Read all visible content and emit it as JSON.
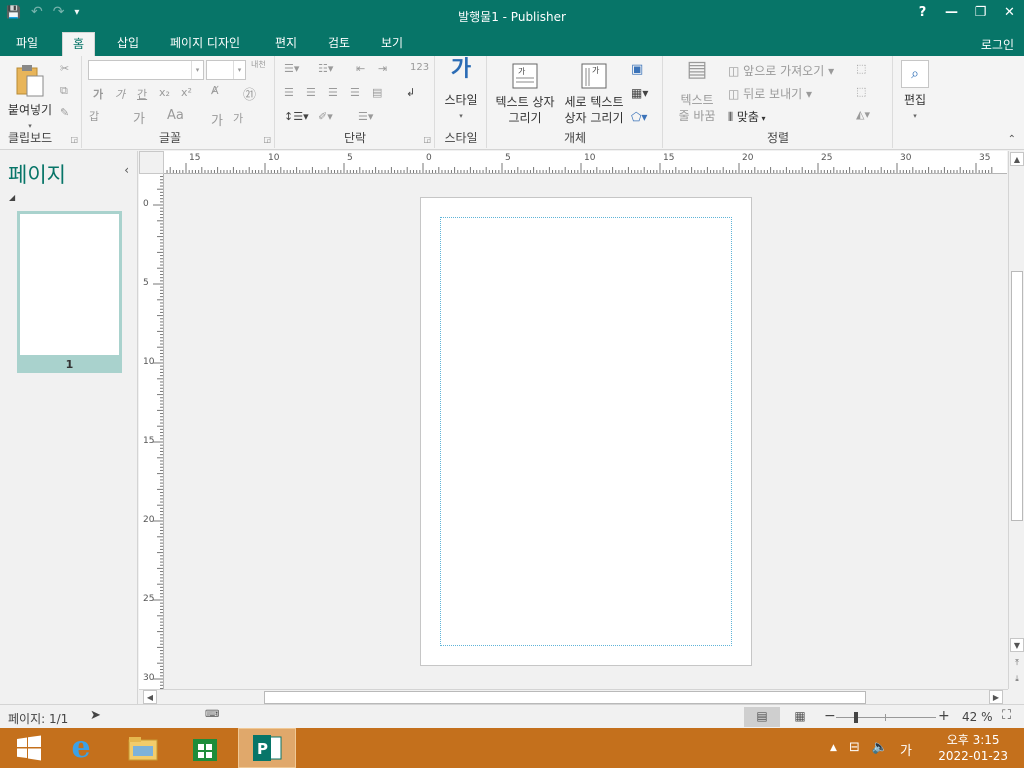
{
  "window": {
    "title": "발행물1 - Publisher",
    "controls": {
      "help": "?",
      "minimize": "—",
      "restore": "❐",
      "close": "✕"
    }
  },
  "qat": {
    "save_icon": "💾",
    "undo_icon": "↶",
    "redo_icon": "↷",
    "customize_icon": "▾"
  },
  "ribbon": {
    "tabs": [
      "파일",
      "홈",
      "삽입",
      "페이지 디자인",
      "편지",
      "검토",
      "보기"
    ],
    "active_tab": "홈",
    "login": "로그인",
    "clipboard": {
      "paste_label": "붙여넣기",
      "group_label": "클립보드"
    },
    "font": {
      "group_label": "글꼴",
      "font_name": "",
      "font_size": "",
      "bold": "가",
      "italic": "가",
      "underline": "간",
      "subscript": "x₂",
      "superscript": "x²",
      "char_spacing": "갑",
      "change_case": "Aa",
      "font_color": "가",
      "grow": "가",
      "shrink": "가",
      "ruby": "내천",
      "enclose": "㉑"
    },
    "paragraph": {
      "group_label": "단락",
      "numbering": "123"
    },
    "styles": {
      "label": "스타일",
      "group_label": "스타일"
    },
    "objects": {
      "group_label": "개체",
      "text_box_label_1": "텍스트 상자",
      "text_box_label_2": "그리기",
      "vertical_text_label_1": "세로 텍스트",
      "vertical_text_label_2": "상자 그리기"
    },
    "arrange": {
      "group_label": "정렬",
      "wrap_text_1": "텍스트",
      "wrap_text_2": "줄 바꿈",
      "bring_forward": "앞으로 가져오기",
      "send_backward": "뒤로 보내기",
      "align": "맞춤"
    },
    "editing": {
      "label": "편집"
    }
  },
  "page_pane": {
    "title": "페이지",
    "thumbnail_number": "1"
  },
  "rulers": {
    "h_labels": [
      "15",
      "10",
      "5",
      "0",
      "5",
      "10",
      "15",
      "20",
      "25",
      "30",
      "35"
    ],
    "v_labels": [
      "0",
      "5",
      "10",
      "15",
      "20",
      "25",
      "30"
    ]
  },
  "status": {
    "page_info": "페이지: 1/1",
    "zoom": "42 %",
    "zoom_fraction": 0.42
  },
  "taskbar": {
    "time": "오후 3:15",
    "date": "2022-01-23",
    "ime": "가"
  },
  "colors": {
    "accent": "#077568",
    "taskbar": "#c4701c"
  }
}
